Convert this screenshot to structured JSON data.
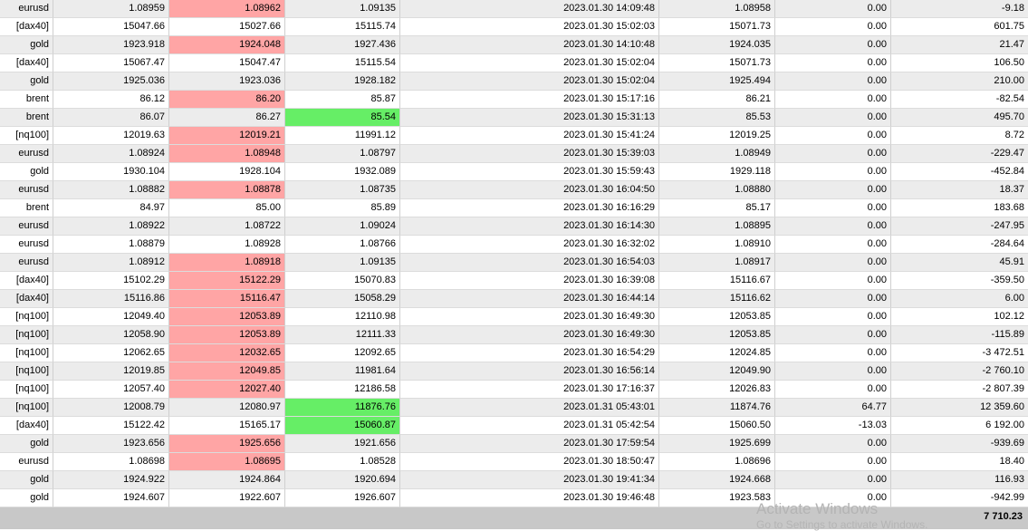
{
  "rows": [
    [
      "eurusd",
      "1.08959",
      "1.08962",
      "1.09135",
      "2023.01.30 14:09:48",
      "1.08958",
      "0.00",
      "-9.18"
    ],
    [
      "[dax40]",
      "15047.66",
      "15027.66",
      "15115.74",
      "2023.01.30 15:02:03",
      "15071.73",
      "0.00",
      "601.75"
    ],
    [
      "gold",
      "1923.918",
      "1924.048",
      "1927.436",
      "2023.01.30 14:10:48",
      "1924.035",
      "0.00",
      "21.47"
    ],
    [
      "[dax40]",
      "15067.47",
      "15047.47",
      "15115.54",
      "2023.01.30 15:02:04",
      "15071.73",
      "0.00",
      "106.50"
    ],
    [
      "gold",
      "1925.036",
      "1923.036",
      "1928.182",
      "2023.01.30 15:02:04",
      "1925.494",
      "0.00",
      "210.00"
    ],
    [
      "brent",
      "86.12",
      "86.20",
      "85.87",
      "2023.01.30 15:17:16",
      "86.21",
      "0.00",
      "-82.54"
    ],
    [
      "brent",
      "86.07",
      "86.27",
      "85.54",
      "2023.01.30 15:31:13",
      "85.53",
      "0.00",
      "495.70"
    ],
    [
      "[nq100]",
      "12019.63",
      "12019.21",
      "11991.12",
      "2023.01.30 15:41:24",
      "12019.25",
      "0.00",
      "8.72"
    ],
    [
      "eurusd",
      "1.08924",
      "1.08948",
      "1.08797",
      "2023.01.30 15:39:03",
      "1.08949",
      "0.00",
      "-229.47"
    ],
    [
      "gold",
      "1930.104",
      "1928.104",
      "1932.089",
      "2023.01.30 15:59:43",
      "1929.118",
      "0.00",
      "-452.84"
    ],
    [
      "eurusd",
      "1.08882",
      "1.08878",
      "1.08735",
      "2023.01.30 16:04:50",
      "1.08880",
      "0.00",
      "18.37"
    ],
    [
      "brent",
      "84.97",
      "85.00",
      "85.89",
      "2023.01.30 16:16:29",
      "85.17",
      "0.00",
      "183.68"
    ],
    [
      "eurusd",
      "1.08922",
      "1.08722",
      "1.09024",
      "2023.01.30 16:14:30",
      "1.08895",
      "0.00",
      "-247.95"
    ],
    [
      "eurusd",
      "1.08879",
      "1.08928",
      "1.08766",
      "2023.01.30 16:32:02",
      "1.08910",
      "0.00",
      "-284.64"
    ],
    [
      "eurusd",
      "1.08912",
      "1.08918",
      "1.09135",
      "2023.01.30 16:54:03",
      "1.08917",
      "0.00",
      "45.91"
    ],
    [
      "[dax40]",
      "15102.29",
      "15122.29",
      "15070.83",
      "2023.01.30 16:39:08",
      "15116.67",
      "0.00",
      "-359.50"
    ],
    [
      "[dax40]",
      "15116.86",
      "15116.47",
      "15058.29",
      "2023.01.30 16:44:14",
      "15116.62",
      "0.00",
      "6.00"
    ],
    [
      "[nq100]",
      "12049.40",
      "12053.89",
      "12110.98",
      "2023.01.30 16:49:30",
      "12053.85",
      "0.00",
      "102.12"
    ],
    [
      "[nq100]",
      "12058.90",
      "12053.89",
      "12111.33",
      "2023.01.30 16:49:30",
      "12053.85",
      "0.00",
      "-115.89"
    ],
    [
      "[nq100]",
      "12062.65",
      "12032.65",
      "12092.65",
      "2023.01.30 16:54:29",
      "12024.85",
      "0.00",
      "-3 472.51"
    ],
    [
      "[nq100]",
      "12019.85",
      "12049.85",
      "11981.64",
      "2023.01.30 16:56:14",
      "12049.90",
      "0.00",
      "-2 760.10"
    ],
    [
      "[nq100]",
      "12057.40",
      "12027.40",
      "12186.58",
      "2023.01.30 17:16:37",
      "12026.83",
      "0.00",
      "-2 807.39"
    ],
    [
      "[nq100]",
      "12008.79",
      "12080.97",
      "11876.76",
      "2023.01.31 05:43:01",
      "11874.76",
      "64.77",
      "12 359.60"
    ],
    [
      "[dax40]",
      "15122.42",
      "15165.17",
      "15060.87",
      "2023.01.31 05:42:54",
      "15060.50",
      "-13.03",
      "6 192.00"
    ],
    [
      "gold",
      "1923.656",
      "1925.656",
      "1921.656",
      "2023.01.30 17:59:54",
      "1925.699",
      "0.00",
      "-939.69"
    ],
    [
      "eurusd",
      "1.08698",
      "1.08695",
      "1.08528",
      "2023.01.30 18:50:47",
      "1.08696",
      "0.00",
      "18.40"
    ],
    [
      "gold",
      "1924.922",
      "1924.864",
      "1920.694",
      "2023.01.30 19:41:34",
      "1924.668",
      "0.00",
      "116.93"
    ],
    [
      "gold",
      "1924.607",
      "1922.607",
      "1926.607",
      "2023.01.30 19:46:48",
      "1923.583",
      "0.00",
      "-942.99"
    ]
  ],
  "highlights": [
    {
      "row": 0,
      "col": 2,
      "color": "red"
    },
    {
      "row": 2,
      "col": 2,
      "color": "red"
    },
    {
      "row": 5,
      "col": 2,
      "color": "red"
    },
    {
      "row": 6,
      "col": 3,
      "color": "green"
    },
    {
      "row": 7,
      "col": 2,
      "color": "red"
    },
    {
      "row": 8,
      "col": 2,
      "color": "red"
    },
    {
      "row": 10,
      "col": 2,
      "color": "red"
    },
    {
      "row": 14,
      "col": 2,
      "color": "red"
    },
    {
      "row": 15,
      "col": 2,
      "color": "red"
    },
    {
      "row": 16,
      "col": 2,
      "color": "red"
    },
    {
      "row": 17,
      "col": 2,
      "color": "red"
    },
    {
      "row": 18,
      "col": 2,
      "color": "red"
    },
    {
      "row": 19,
      "col": 2,
      "color": "red"
    },
    {
      "row": 20,
      "col": 2,
      "color": "red"
    },
    {
      "row": 21,
      "col": 2,
      "color": "red"
    },
    {
      "row": 22,
      "col": 3,
      "color": "green"
    },
    {
      "row": 23,
      "col": 3,
      "color": "green"
    },
    {
      "row": 24,
      "col": 2,
      "color": "red"
    },
    {
      "row": 25,
      "col": 2,
      "color": "red"
    }
  ],
  "colors": {
    "red_highlight": "#ffa5a5",
    "green_highlight": "#66ee66",
    "row_alt": "#ececec",
    "totals_bar": "#c8c8c8"
  },
  "totals": {
    "profit": "7 710.23"
  },
  "watermark": {
    "title": "Activate Windows",
    "subtitle": "Go to Settings to activate Windows."
  }
}
